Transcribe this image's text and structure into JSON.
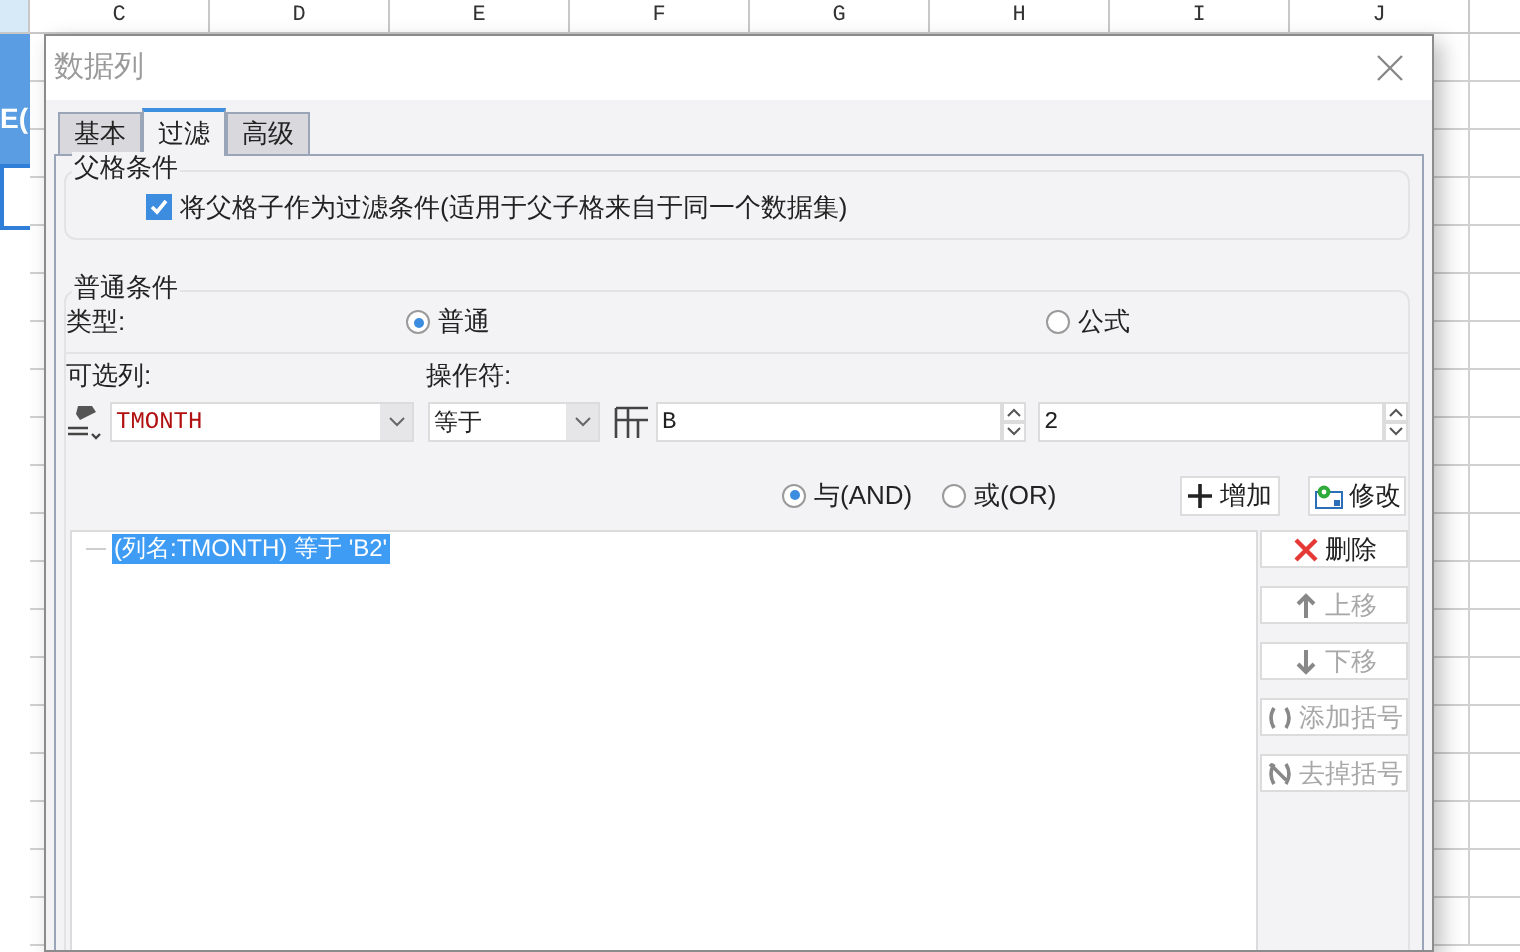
{
  "sheet": {
    "columns": [
      "C",
      "D",
      "E",
      "F",
      "G",
      "H",
      "I",
      "J"
    ],
    "cell_text": "E("
  },
  "dialog": {
    "title": "数据列",
    "tabs": [
      {
        "label": "基本",
        "selected": false
      },
      {
        "label": "过滤",
        "selected": true
      },
      {
        "label": "高级",
        "selected": false
      }
    ],
    "parent_condition": {
      "legend": "父格条件",
      "checkbox": {
        "label": "将父格子作为过滤条件(适用于父子格来自于同一个数据集)",
        "checked": true
      }
    },
    "normal_condition": {
      "legend": "普通条件",
      "type_label": "类型:",
      "type_options": [
        {
          "label": "普通",
          "selected": true
        },
        {
          "label": "公式",
          "selected": false
        }
      ],
      "column_label": "可选列:",
      "operator_label": "操作符:",
      "column_value": "TMONTH",
      "operator_value": "等于",
      "value_1": "B",
      "value_2": "2"
    },
    "logic_options": [
      {
        "label": "与(AND)",
        "selected": true
      },
      {
        "label": "或(OR)",
        "selected": false
      }
    ],
    "add_button": "增加",
    "modify_button": "修改",
    "conditions": [
      {
        "text": "(列名:TMONTH) 等于 'B2'",
        "selected": true
      }
    ],
    "side_buttons": [
      {
        "kind": "delete",
        "label": "删除",
        "disabled": false
      },
      {
        "kind": "up",
        "label": "上移",
        "disabled": true
      },
      {
        "kind": "down",
        "label": "下移",
        "disabled": true
      },
      {
        "kind": "add_paren",
        "label": "添加括号",
        "disabled": true
      },
      {
        "kind": "remove_paren",
        "label": "去掉括号",
        "disabled": true
      }
    ]
  }
}
